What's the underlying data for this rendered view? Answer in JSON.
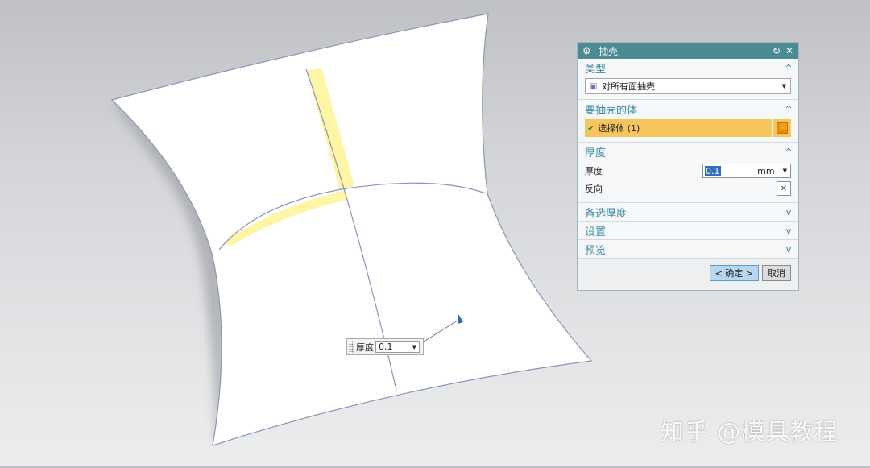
{
  "hud": {
    "label": "厚度",
    "value": "0.1"
  },
  "dialog": {
    "title": "抽壳",
    "sections": {
      "type": {
        "header": "类型",
        "select_value": "对所有面抽壳"
      },
      "body": {
        "header": "要抽壳的体",
        "select_label": "选择体 (1)"
      },
      "thickness": {
        "header": "厚度",
        "label": "厚度",
        "value": "0.1",
        "unit": "mm",
        "reverse_label": "反向"
      },
      "alt_thickness": {
        "header": "备选厚度"
      },
      "settings": {
        "header": "设置"
      },
      "preview": {
        "header": "预览"
      }
    },
    "ok_label": "< 确定 >",
    "cancel_label": "取消"
  },
  "watermark": "知乎 @模具教程",
  "colors": {
    "title_bar": "#4c8a94",
    "section_header": "#3a8da0",
    "selection_highlight": "#f7c55e",
    "ok_button": "#b8d7ee"
  }
}
